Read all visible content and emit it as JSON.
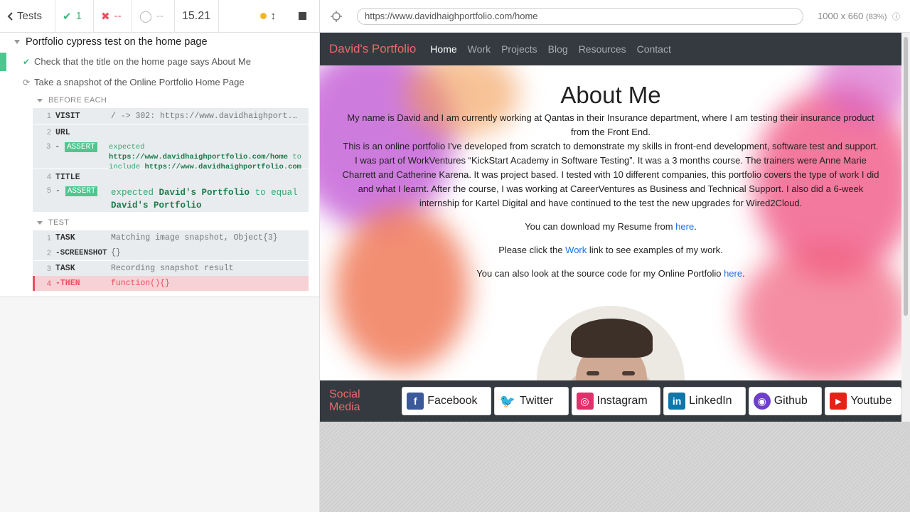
{
  "runner": {
    "tests_label": "Tests",
    "passed": "1",
    "failed": "--",
    "pending": "--",
    "duration": "15.21"
  },
  "suite": {
    "title": "Portfolio cypress test on the home page"
  },
  "tests": [
    {
      "title": "Check that the title on the home page says About Me",
      "state": "passed"
    },
    {
      "title": "Take a snapshot of the Online Portfolio Home Page",
      "state": "running"
    }
  ],
  "hooks": {
    "before_each": "BEFORE EACH",
    "test": "TEST"
  },
  "commands_before": [
    {
      "num": "1",
      "name": "VISIT",
      "message": "/ -> 302: https://www.davidhaighport..."
    },
    {
      "num": "2",
      "name": "URL"
    },
    {
      "num": "3",
      "name": "ASSERT",
      "expected": "expected",
      "actual": "https://www.davidhaighportfolio.com/home",
      "to": "to",
      "include": "include",
      "target": "https://www.davidhaighportfolio.com"
    },
    {
      "num": "4",
      "name": "TITLE"
    },
    {
      "num": "5",
      "name": "ASSERT",
      "expected": "expected",
      "actual": "David's Portfolio",
      "to_equal": "to equal",
      "target": "David's Portfolio"
    }
  ],
  "commands_test": [
    {
      "num": "1",
      "name": "TASK",
      "message": "Matching image snapshot, Object{3}"
    },
    {
      "num": "2",
      "name": "-SCREENSHOT",
      "message": "{}"
    },
    {
      "num": "3",
      "name": "TASK",
      "message": "Recording snapshot result"
    },
    {
      "num": "4",
      "name": "-THEN",
      "message": "function(){}"
    }
  ],
  "browser": {
    "url": "https://www.davidhaighportfolio.com/home",
    "viewport": "1000 x 660",
    "scale": "(83%)"
  },
  "site": {
    "brand": "David's Portfolio",
    "nav": [
      "Home",
      "Work",
      "Projects",
      "Blog",
      "Resources",
      "Contact"
    ],
    "heading": "About Me",
    "para1": "My name is David and I am currently working at Qantas in their Insurance department, where I am testing their insurance product from the Front End.",
    "para2": "This is an online portfolio I've developed from scratch to demonstrate my skills in front-end development, software test and support. I was part of WorkVentures “KickStart Academy in Software Testing”. It was a 3 months course. The trainers were Anne Marie Charrett and Catherine Karena. It was project based. I tested with 10 different companies, this portfolio covers the type of work I did and what I learnt. After the course, I was working at CareerVentures as Business and Technical Support. I also did a 6-week internship for Kartel Digital and have continued to the test the new upgrades for Wired2Cloud.",
    "resume_pre": "You can download my Resume from ",
    "resume_link": "here",
    "resume_post": ".",
    "work_pre": "Please click the ",
    "work_link": "Work",
    "work_post": " link to see examples of my work.",
    "source_pre": "You can also look at the source code for my Online Portfolio ",
    "source_link": "here",
    "source_post": ".",
    "social_label": "Social Media",
    "social": [
      {
        "label": "Facebook",
        "icon": "facebook-icon",
        "color": "#3b5998"
      },
      {
        "label": "Twitter",
        "icon": "twitter-icon",
        "color": "#1da1f2"
      },
      {
        "label": "Instagram",
        "icon": "instagram-icon",
        "color": "#e1306c"
      },
      {
        "label": "LinkedIn",
        "icon": "linkedin-icon",
        "color": "#0e76a8"
      },
      {
        "label": "Github",
        "icon": "github-icon",
        "color": "#6e40c9"
      },
      {
        "label": "Youtube",
        "icon": "youtube-icon",
        "color": "#e62117"
      }
    ]
  }
}
